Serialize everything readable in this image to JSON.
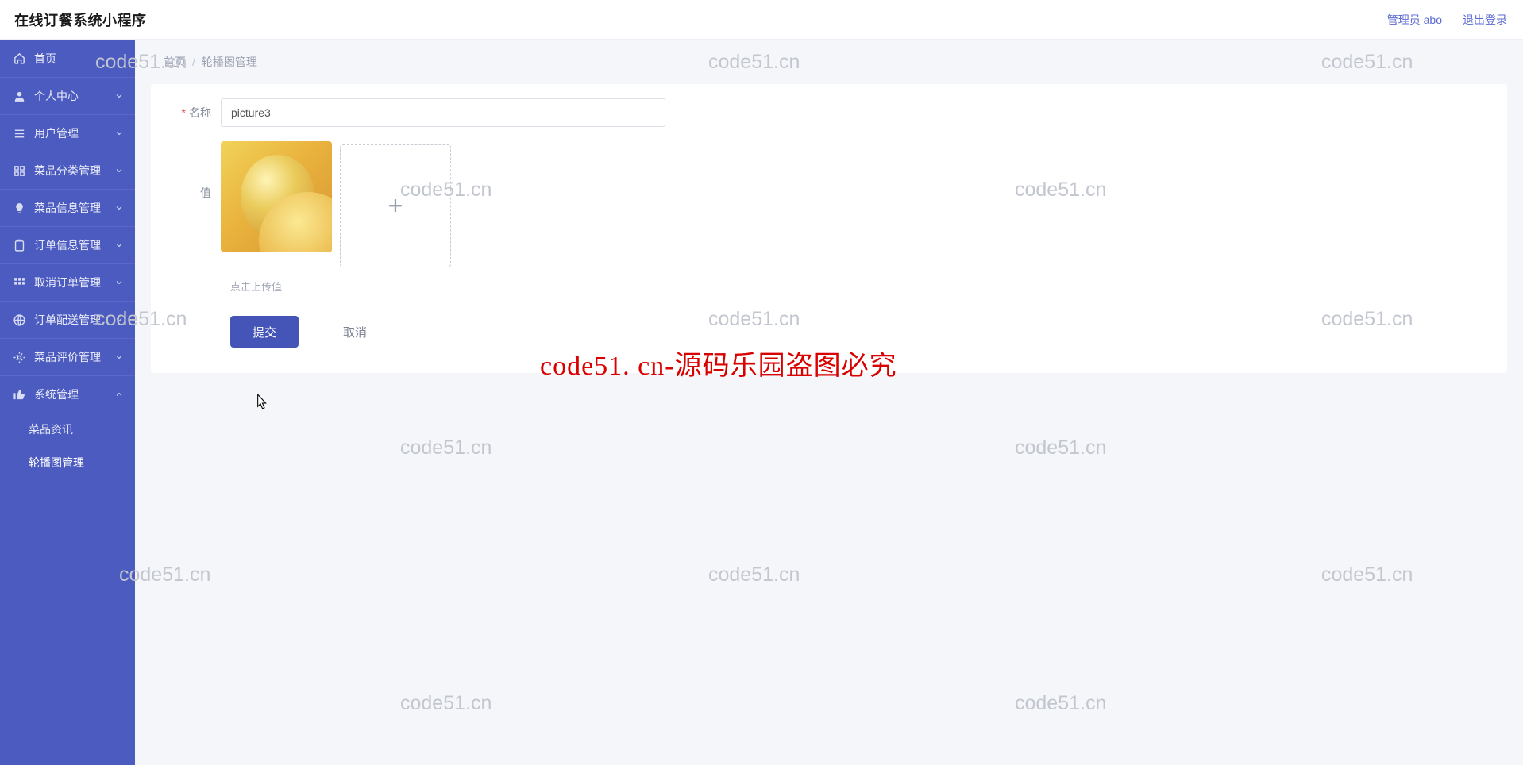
{
  "app_title": "在线订餐系统小程序",
  "header": {
    "admin_label": "管理员 abo",
    "logout_label": "退出登录"
  },
  "sidebar": {
    "items": [
      {
        "key": "home",
        "label": "首页",
        "expandable": false
      },
      {
        "key": "profile",
        "label": "个人中心",
        "expandable": true
      },
      {
        "key": "users",
        "label": "用户管理",
        "expandable": true
      },
      {
        "key": "category",
        "label": "菜品分类管理",
        "expandable": true
      },
      {
        "key": "dish",
        "label": "菜品信息管理",
        "expandable": true
      },
      {
        "key": "order",
        "label": "订单信息管理",
        "expandable": true
      },
      {
        "key": "cancel",
        "label": "取消订单管理",
        "expandable": true
      },
      {
        "key": "delivery",
        "label": "订单配送管理",
        "expandable": true
      },
      {
        "key": "review",
        "label": "菜品评价管理",
        "expandable": true
      },
      {
        "key": "system",
        "label": "系统管理",
        "expandable": true
      }
    ],
    "system_sub": [
      {
        "label": "菜品资讯",
        "active": false
      },
      {
        "label": "轮播图管理",
        "active": true
      }
    ]
  },
  "breadcrumb": {
    "home": "首页",
    "sep": "/",
    "current": "轮播图管理"
  },
  "form": {
    "name_label": "名称",
    "name_value": "picture3",
    "value_label": "值",
    "upload_hint": "点击上传值",
    "submit_label": "提交",
    "cancel_label": "取消"
  },
  "upload_plus": "+",
  "watermark": "code51.cn",
  "red_banner": "code51. cn-源码乐园盗图必究"
}
